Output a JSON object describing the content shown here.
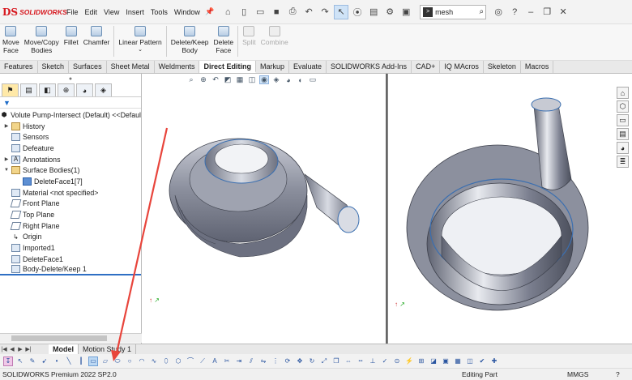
{
  "app": {
    "logo_mark": "DS",
    "logo_text": "SOLIDWORKS"
  },
  "menu": [
    "File",
    "Edit",
    "View",
    "Insert",
    "Tools",
    "Window"
  ],
  "search": {
    "value": "mesh"
  },
  "commands": [
    {
      "label": "Move\nFace",
      "enabled": true
    },
    {
      "label": "Move/Copy\nBodies",
      "enabled": true
    },
    {
      "label": "Fillet",
      "enabled": true
    },
    {
      "label": "Chamfer",
      "enabled": true
    },
    {
      "label": "Linear Pattern",
      "enabled": true
    },
    {
      "label": "Delete/Keep\nBody",
      "enabled": true
    },
    {
      "label": "Delete\nFace",
      "enabled": true
    },
    {
      "label": "Split",
      "enabled": false
    },
    {
      "label": "Combine",
      "enabled": false
    }
  ],
  "tabs": [
    "Features",
    "Sketch",
    "Surfaces",
    "Sheet Metal",
    "Weldments",
    "Direct Editing",
    "Markup",
    "Evaluate",
    "SOLIDWORKS Add-Ins",
    "CAD+",
    "IQ MAcros",
    "Skeleton",
    "Macros"
  ],
  "active_tab": "Direct Editing",
  "tree": {
    "root": "Volute Pump-Intersect (Default) <<Defaul",
    "items": [
      {
        "label": "History",
        "expander": "▶",
        "icon": "fol"
      },
      {
        "label": "Sensors",
        "expander": "",
        "icon": "sq"
      },
      {
        "label": "Defeature",
        "expander": "",
        "icon": "sq"
      },
      {
        "label": "Annotations",
        "expander": "▶",
        "icon": "sq"
      },
      {
        "label": "Surface Bodies(1)",
        "expander": "▼",
        "icon": "fol"
      },
      {
        "label": "DeleteFace1[7]",
        "expander": "",
        "icon": "blue",
        "indent": true
      },
      {
        "label": "Material <not specified>",
        "expander": "",
        "icon": "sq"
      },
      {
        "label": "Front Plane",
        "expander": "",
        "icon": "pl"
      },
      {
        "label": "Top Plane",
        "expander": "",
        "icon": "pl"
      },
      {
        "label": "Right Plane",
        "expander": "",
        "icon": "pl"
      },
      {
        "label": "Origin",
        "expander": "",
        "icon": "origin"
      },
      {
        "label": "Imported1",
        "expander": "",
        "icon": "sq"
      },
      {
        "label": "DeleteFace1",
        "expander": "",
        "icon": "sq"
      },
      {
        "label": "Body-Delete/Keep 1",
        "expander": "",
        "icon": "sq"
      }
    ]
  },
  "bottom_tabs": [
    "Model",
    "Motion Study 1"
  ],
  "active_bottom_tab": "Model",
  "status": {
    "product": "SOLIDWORKS Premium 2022 SP2.0",
    "mode": "Editing Part",
    "units": "MMGS"
  },
  "colors": {
    "annotation_arrow": "#e8453c",
    "logo_red": "#d71920",
    "selection_blue": "#2f6fc4"
  }
}
